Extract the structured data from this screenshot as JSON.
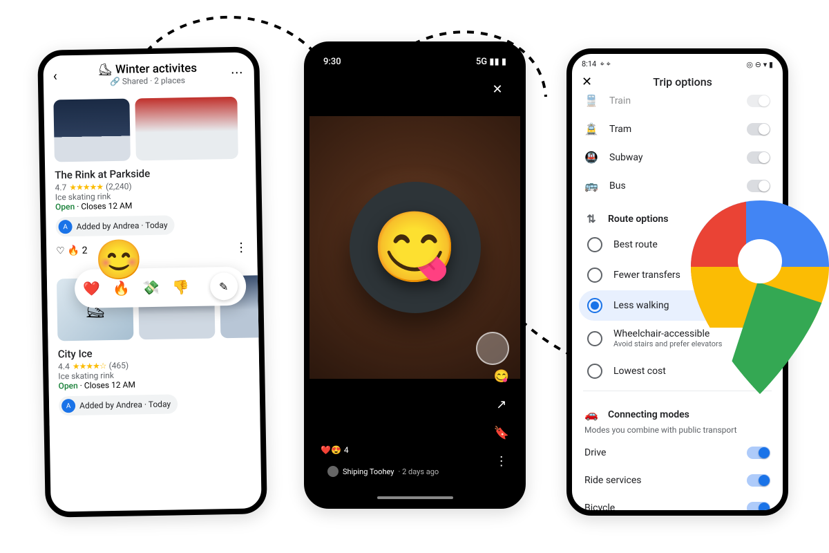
{
  "listScreen": {
    "title": "Winter activites",
    "titleEmoji": "⛸",
    "subtitle": "Shared · 2 places",
    "place1": {
      "name": "The Rink at Parkside",
      "rating": "4.7",
      "reviewCount": "(2,240)",
      "category": "Ice skating rink",
      "openLabel": "Open",
      "hoursLabel": " · Closes 12 AM",
      "addedBy": "Added by Andrea · Today",
      "reactions": "🔥 2"
    },
    "reactionPalette": [
      "❤️",
      "🔥",
      "💸",
      "👎"
    ],
    "bigEmoji": "😊",
    "place2": {
      "name": "City Ice",
      "rating": "4.4",
      "reviewCount": "(465)",
      "category": "Ice skating rink",
      "openLabel": "Open",
      "hoursLabel": " · Closes 12 AM",
      "addedBy": "Added by Andrea · Today"
    }
  },
  "storyScreen": {
    "time": "9:30",
    "networkLabel": "5G",
    "foodEmoji": "😋",
    "reactCount": "4",
    "reactIcons": "❤️😍",
    "author": "Shiping Toohey",
    "ago": "· 2 days ago",
    "sideEmoji": "😋"
  },
  "tripOptions": {
    "statusTime": "8:14",
    "headerTitle": "Trip options",
    "transitModes": [
      {
        "icon": "🚆",
        "label": "Train",
        "on": false,
        "cut": true
      },
      {
        "icon": "🚊",
        "label": "Tram",
        "on": false
      },
      {
        "icon": "🚇",
        "label": "Subway",
        "on": false
      },
      {
        "icon": "🚌",
        "label": "Bus",
        "on": false
      }
    ],
    "routeTitle": "Route options",
    "routeOptions": [
      {
        "label": "Best route",
        "selected": false
      },
      {
        "label": "Fewer transfers",
        "selected": false
      },
      {
        "label": "Less walking",
        "selected": true
      },
      {
        "label": "Wheelchair-accessible",
        "sub": "Avoid stairs and prefer elevators",
        "selected": false
      },
      {
        "label": "Lowest cost",
        "selected": false
      }
    ],
    "connectingTitle": "Connecting modes",
    "connectingSub": "Modes you combine with public transport",
    "connectingModes": [
      {
        "label": "Drive",
        "on": true
      },
      {
        "label": "Ride services",
        "on": true
      },
      {
        "label": "Bicycle",
        "on": true
      }
    ]
  }
}
